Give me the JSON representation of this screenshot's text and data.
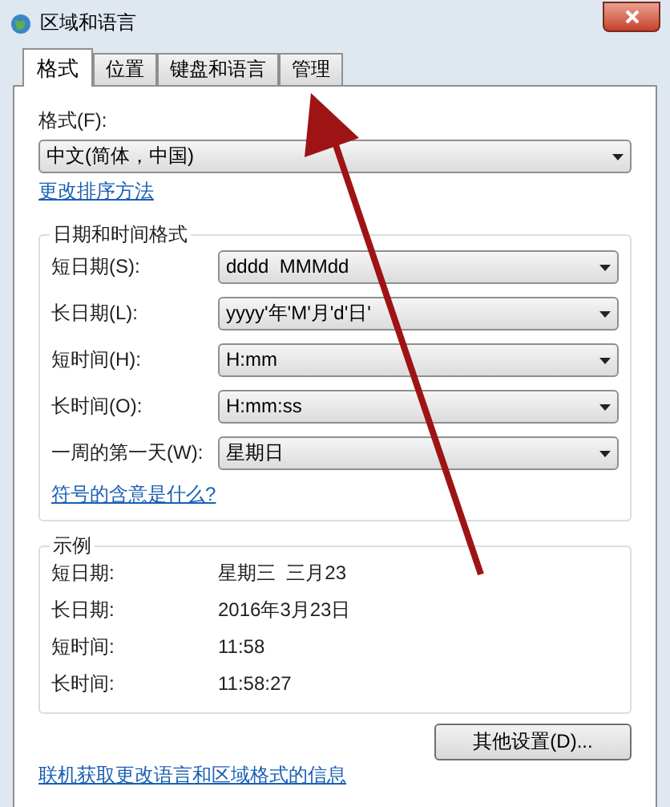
{
  "window": {
    "title": "区域和语言"
  },
  "tabs": [
    {
      "label": "格式",
      "selected": true
    },
    {
      "label": "位置",
      "selected": false
    },
    {
      "label": "键盘和语言",
      "selected": false
    },
    {
      "label": "管理",
      "selected": false
    }
  ],
  "format": {
    "label": "格式(F):",
    "value": "中文(简体，中国)",
    "link": "更改排序方法"
  },
  "date_time_formats": {
    "title": "日期和时间格式",
    "rows": [
      {
        "label": "短日期(S):",
        "value": "dddd  MMMdd"
      },
      {
        "label": "长日期(L):",
        "value": "yyyy'年'M'月'd'日'"
      },
      {
        "label": "短时间(H):",
        "value": "H:mm"
      },
      {
        "label": "长时间(O):",
        "value": "H:mm:ss"
      },
      {
        "label": "一周的第一天(W):",
        "value": "星期日"
      }
    ],
    "link": "符号的含意是什么?"
  },
  "examples": {
    "title": "示例",
    "rows": [
      {
        "label": "短日期:",
        "value": "星期三  三月23"
      },
      {
        "label": "长日期:",
        "value": "2016年3月23日"
      },
      {
        "label": "短时间:",
        "value": "11:58"
      },
      {
        "label": "长时间:",
        "value": "11:58:27"
      }
    ]
  },
  "other_settings_button": "其他设置(D)...",
  "footer_link": "联机获取更改语言和区域格式的信息"
}
